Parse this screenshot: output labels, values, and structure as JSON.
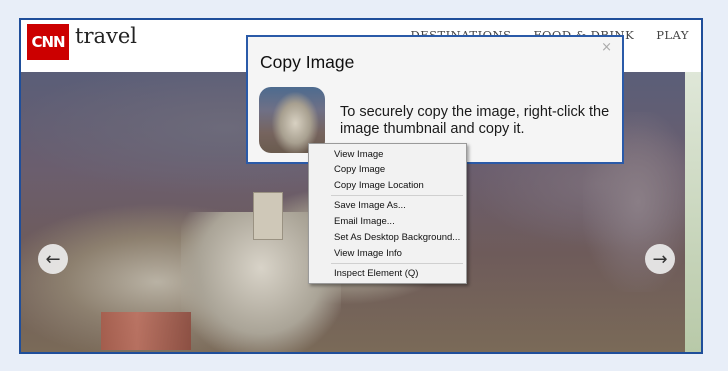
{
  "header": {
    "logo_text": "CNN",
    "brand": "travel",
    "nav": [
      "DESTINATIONS",
      "FOOD & DRINK",
      "PLAY"
    ]
  },
  "colors": {
    "logo_red": "#cc0000",
    "frame_border": "#1f4e9a",
    "dialog_border": "#2a5aa8"
  },
  "carousel": {
    "prev_icon": "arrow-left-icon",
    "next_icon": "arrow-right-icon",
    "prev_glyph": "←",
    "next_glyph": "→"
  },
  "dialog": {
    "title": "Copy Image",
    "close_glyph": "×",
    "message": "To securely copy the image, right-click the image thumbnail and copy it."
  },
  "context_menu": {
    "groups": [
      [
        "View Image",
        "Copy Image",
        "Copy Image Location"
      ],
      [
        "Save Image As...",
        "Email Image...",
        "Set As Desktop Background...",
        "View Image Info"
      ],
      [
        "Inspect Element (Q)"
      ]
    ]
  }
}
